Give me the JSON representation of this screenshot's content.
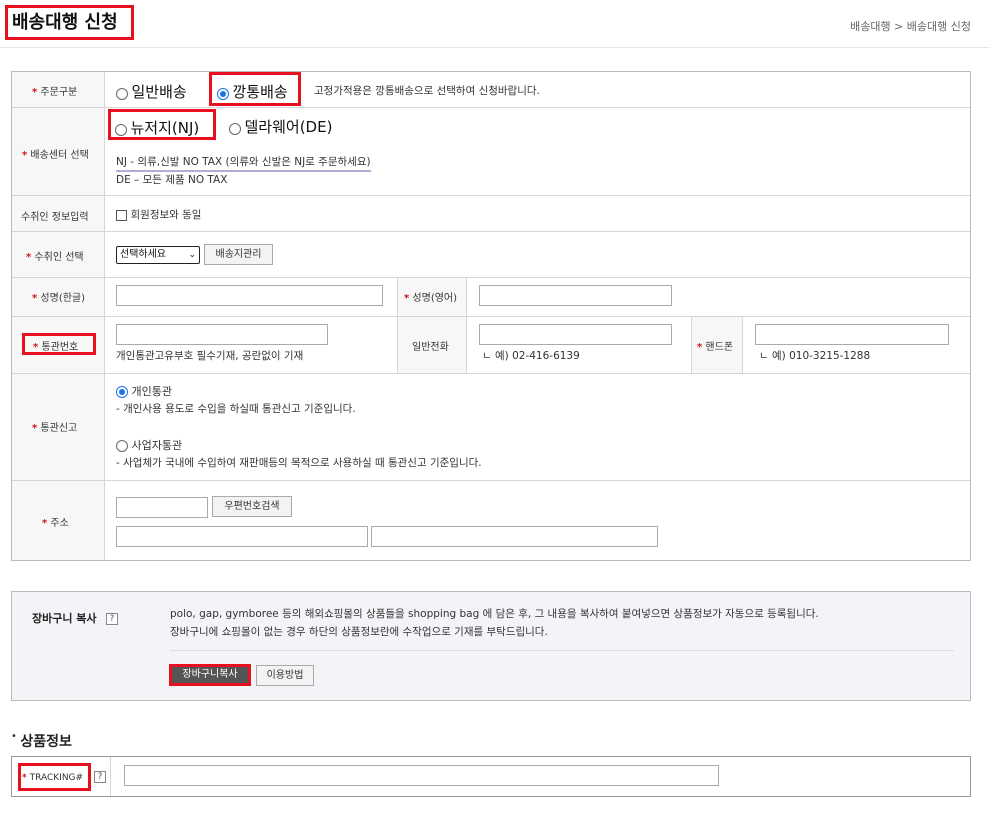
{
  "page": {
    "title": "배송대행 신청",
    "breadcrumb": "배송대행 > 배송대행 신청"
  },
  "order_type": {
    "label": "주문구분",
    "option1": "일반배송",
    "option2": "깡통배송",
    "note": "고정가적용은 깡통배송으로 선택하여 신청바랍니다."
  },
  "center": {
    "label": "배송센터 선택",
    "option1": "뉴저지(NJ)",
    "option2": "델라웨어(DE)",
    "note1": "NJ - 의류,신발 NO TAX (의류와 신발은 NJ로 주문하세요)",
    "note2": "DE – 모든 제품 NO TAX"
  },
  "receiver_info": {
    "label": "수취인 정보입력",
    "checkbox_label": "회원정보와 동일"
  },
  "receiver_select": {
    "label": "수취인 선택",
    "selected": "선택하세요",
    "manage_button": "배송지관리"
  },
  "name": {
    "kr_label": "성명(한글)",
    "en_label": "성명(영어)"
  },
  "customs_no": {
    "label": "통관번호",
    "hint": "개인통관고유부호 필수기재, 공란없이 기재",
    "phone_label": "일반전화",
    "phone_hint": "ㄴ 예) 02-416-6139",
    "mobile_label": "핸드폰",
    "mobile_hint": "ㄴ 예) 010-3215-1288"
  },
  "customs_decl": {
    "label": "통관신고",
    "option1": "개인통관",
    "desc1": "- 개인사용 용도로 수입을 하실때 통관신고 기준입니다.",
    "option2": "사업자통관",
    "desc2": "- 사업체가 국내에 수입하여 재판매등의 목적으로 사용하실 때 통관신고 기준입니다."
  },
  "address": {
    "label": "주소",
    "zip_button": "우편번호검색"
  },
  "cart": {
    "label": "장바구니 복사",
    "help": "?",
    "desc1": "polo, gap, gymboree 등의 해외쇼핑몰의 상품들을 shopping bag 에 담은 후, 그 내용을 복사하여 붙여넣으면 상품정보가 자동으로 등록됩니다.",
    "desc2": "장바구니에 쇼핑몰이 없는 경우 하단의 상품정보란에 수작업으로 기재를 부탁드립니다.",
    "copy_button": "장바구니복사",
    "howto_button": "이용방법"
  },
  "product": {
    "section_title": "상품정보",
    "tracking_label": "TRACKING#",
    "help": "?"
  },
  "req_mark": "*",
  "colors": {
    "highlight_red": "#e8101e",
    "required_red": "#d0121e",
    "radio_blue": "#1a73e8"
  }
}
